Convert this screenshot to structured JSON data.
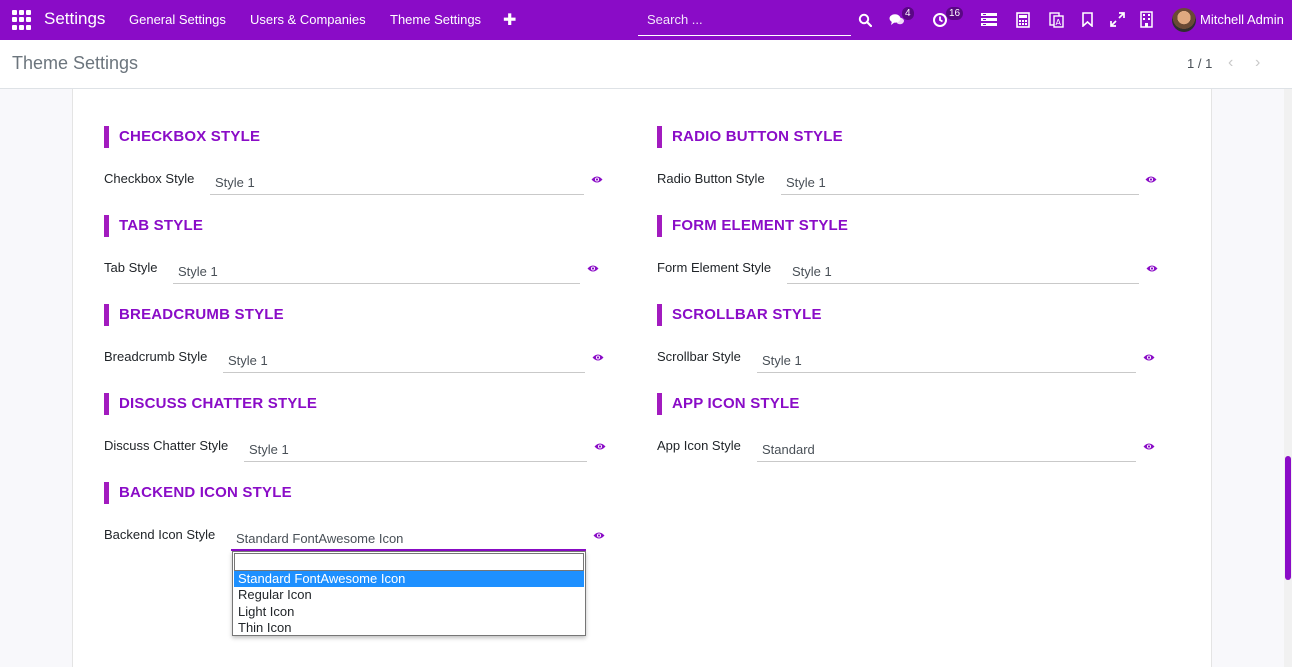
{
  "navbar": {
    "brand": "Settings",
    "menu": [
      "General Settings",
      "Users & Companies",
      "Theme Settings"
    ],
    "add_icon": "plus-icon",
    "search_placeholder": "Search ...",
    "messages_badge": "4",
    "activities_badge": "16",
    "user_name": "Mitchell Admin",
    "accent_color": "#8a0cc7"
  },
  "control_panel": {
    "title": "Theme Settings",
    "pager": "1 / 1"
  },
  "sections": {
    "checkbox": {
      "title": "CHECKBOX STYLE",
      "label": "Checkbox Style",
      "value": "Style 1"
    },
    "radio": {
      "title": "RADIO BUTTON STYLE",
      "label": "Radio Button Style",
      "value": "Style 1"
    },
    "tab": {
      "title": "TAB STYLE",
      "label": "Tab Style",
      "value": "Style 1"
    },
    "form_element": {
      "title": "FORM ELEMENT STYLE",
      "label": "Form Element Style",
      "value": "Style 1"
    },
    "breadcrumb": {
      "title": "BREADCRUMB STYLE",
      "label": "Breadcrumb Style",
      "value": "Style 1"
    },
    "scrollbar": {
      "title": "SCROLLBAR STYLE",
      "label": "Scrollbar Style",
      "value": "Style 1"
    },
    "discuss": {
      "title": "DISCUSS CHATTER STYLE",
      "label": "Discuss Chatter Style",
      "value": "Style 1"
    },
    "app_icon": {
      "title": "APP ICON STYLE",
      "label": "App Icon Style",
      "value": "Standard"
    },
    "backend_icon": {
      "title": "BACKEND ICON STYLE",
      "label": "Backend Icon Style",
      "value": "Standard FontAwesome Icon"
    }
  },
  "backend_icon_dropdown": {
    "options": [
      "Standard FontAwesome Icon",
      "Regular Icon",
      "Light Icon",
      "Thin Icon"
    ],
    "selected": "Standard FontAwesome Icon"
  }
}
